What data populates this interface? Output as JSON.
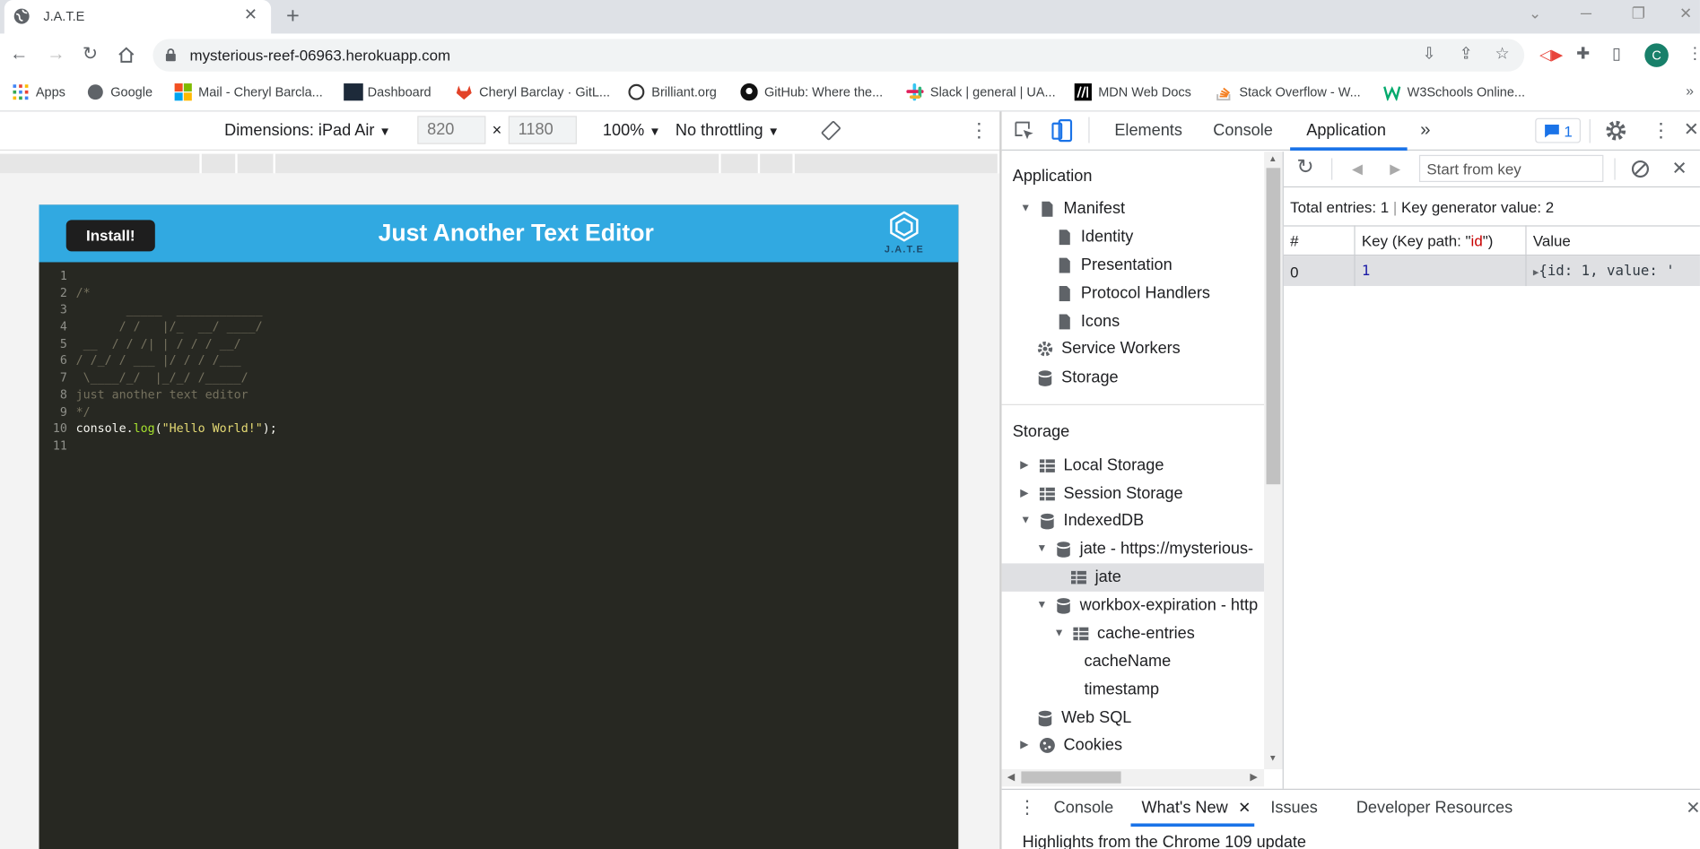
{
  "browser": {
    "tab_title": "J.A.T.E",
    "url": "mysterious-reef-06963.herokuapp.com",
    "avatar_letter": "C",
    "bookmarks": [
      {
        "label": "Apps",
        "color": "#4285f4"
      },
      {
        "label": "Google",
        "color": "#5f6368"
      },
      {
        "label": "Mail - Cheryl Barcla...",
        "color": "#f25022"
      },
      {
        "label": "Dashboard",
        "color": "#1d2a3a"
      },
      {
        "label": "Cheryl Barclay · GitL...",
        "color": "#e24329"
      },
      {
        "label": "Brilliant.org",
        "color": "#333333"
      },
      {
        "label": "GitHub: Where the...",
        "color": "#111111"
      },
      {
        "label": "Slack | general | UA...",
        "color": "#36c5f0"
      },
      {
        "label": "MDN Web Docs",
        "color": "#000000"
      },
      {
        "label": "Stack Overflow - W...",
        "color": "#f48024"
      },
      {
        "label": "W3Schools Online...",
        "color": "#04aa6d"
      }
    ]
  },
  "device_toolbar": {
    "dimensions": "Dimensions: iPad Air",
    "width": "820",
    "x": "×",
    "height": "1180",
    "zoom": "100%",
    "throttling": "No throttling"
  },
  "app": {
    "install_label": "Install!",
    "title": "Just Another Text Editor",
    "logo_text": "J.A.T.E",
    "header_color": "#31a9e1",
    "editor_lines": [
      {
        "n": "1",
        "text": ""
      },
      {
        "n": "2",
        "text": "/*"
      },
      {
        "n": "3",
        "text": "       _____  ____________"
      },
      {
        "n": "4",
        "text": "      / /   |/_  __/ ____/"
      },
      {
        "n": "5",
        "text": " __  / / /| | / / / __/"
      },
      {
        "n": "6",
        "text": "/ /_/ / ___ |/ / / /___"
      },
      {
        "n": "7",
        "text": " \\____/_/  |_/_/ /_____/"
      },
      {
        "n": "8",
        "text": "just another text editor"
      },
      {
        "n": "9",
        "text": "*/"
      },
      {
        "n": "10",
        "text": ""
      },
      {
        "n": "11",
        "text": ""
      }
    ],
    "code": {
      "obj": "console",
      "dot": ".",
      "fn": "log",
      "open": "(",
      "str": "\"Hello World!\"",
      "close": ");"
    }
  },
  "devtools": {
    "tabs": [
      "Elements",
      "Console",
      "Application"
    ],
    "more": "»",
    "issues_count": "1",
    "sidebar": {
      "application_header": "Application",
      "application_items": [
        "Manifest",
        "Identity",
        "Presentation",
        "Protocol Handlers",
        "Icons",
        "Service Workers",
        "Storage"
      ],
      "storage_header": "Storage",
      "storage_items": [
        "Local Storage",
        "Session Storage",
        "IndexedDB",
        "jate - https://mysterious-",
        "jate",
        "workbox-expiration - http",
        "cache-entries",
        "cacheName",
        "timestamp",
        "Web SQL",
        "Cookies"
      ]
    },
    "data": {
      "start_from_key": "Start from key",
      "total_entries": "Total entries: 1",
      "separator": "|",
      "key_generator": "Key generator value: 2",
      "columns": {
        "num": "#",
        "key_prefix": "Key (Key path: \"",
        "key_path": "id",
        "key_suffix": "\")",
        "value": "Value"
      },
      "row": {
        "num": "0",
        "key": "1",
        "value": "{id: 1, value: '"
      }
    },
    "drawer": {
      "tabs": [
        "Console",
        "What's New",
        "Issues",
        "Developer Resources"
      ],
      "highlights": "Highlights from the Chrome 109 update"
    }
  }
}
